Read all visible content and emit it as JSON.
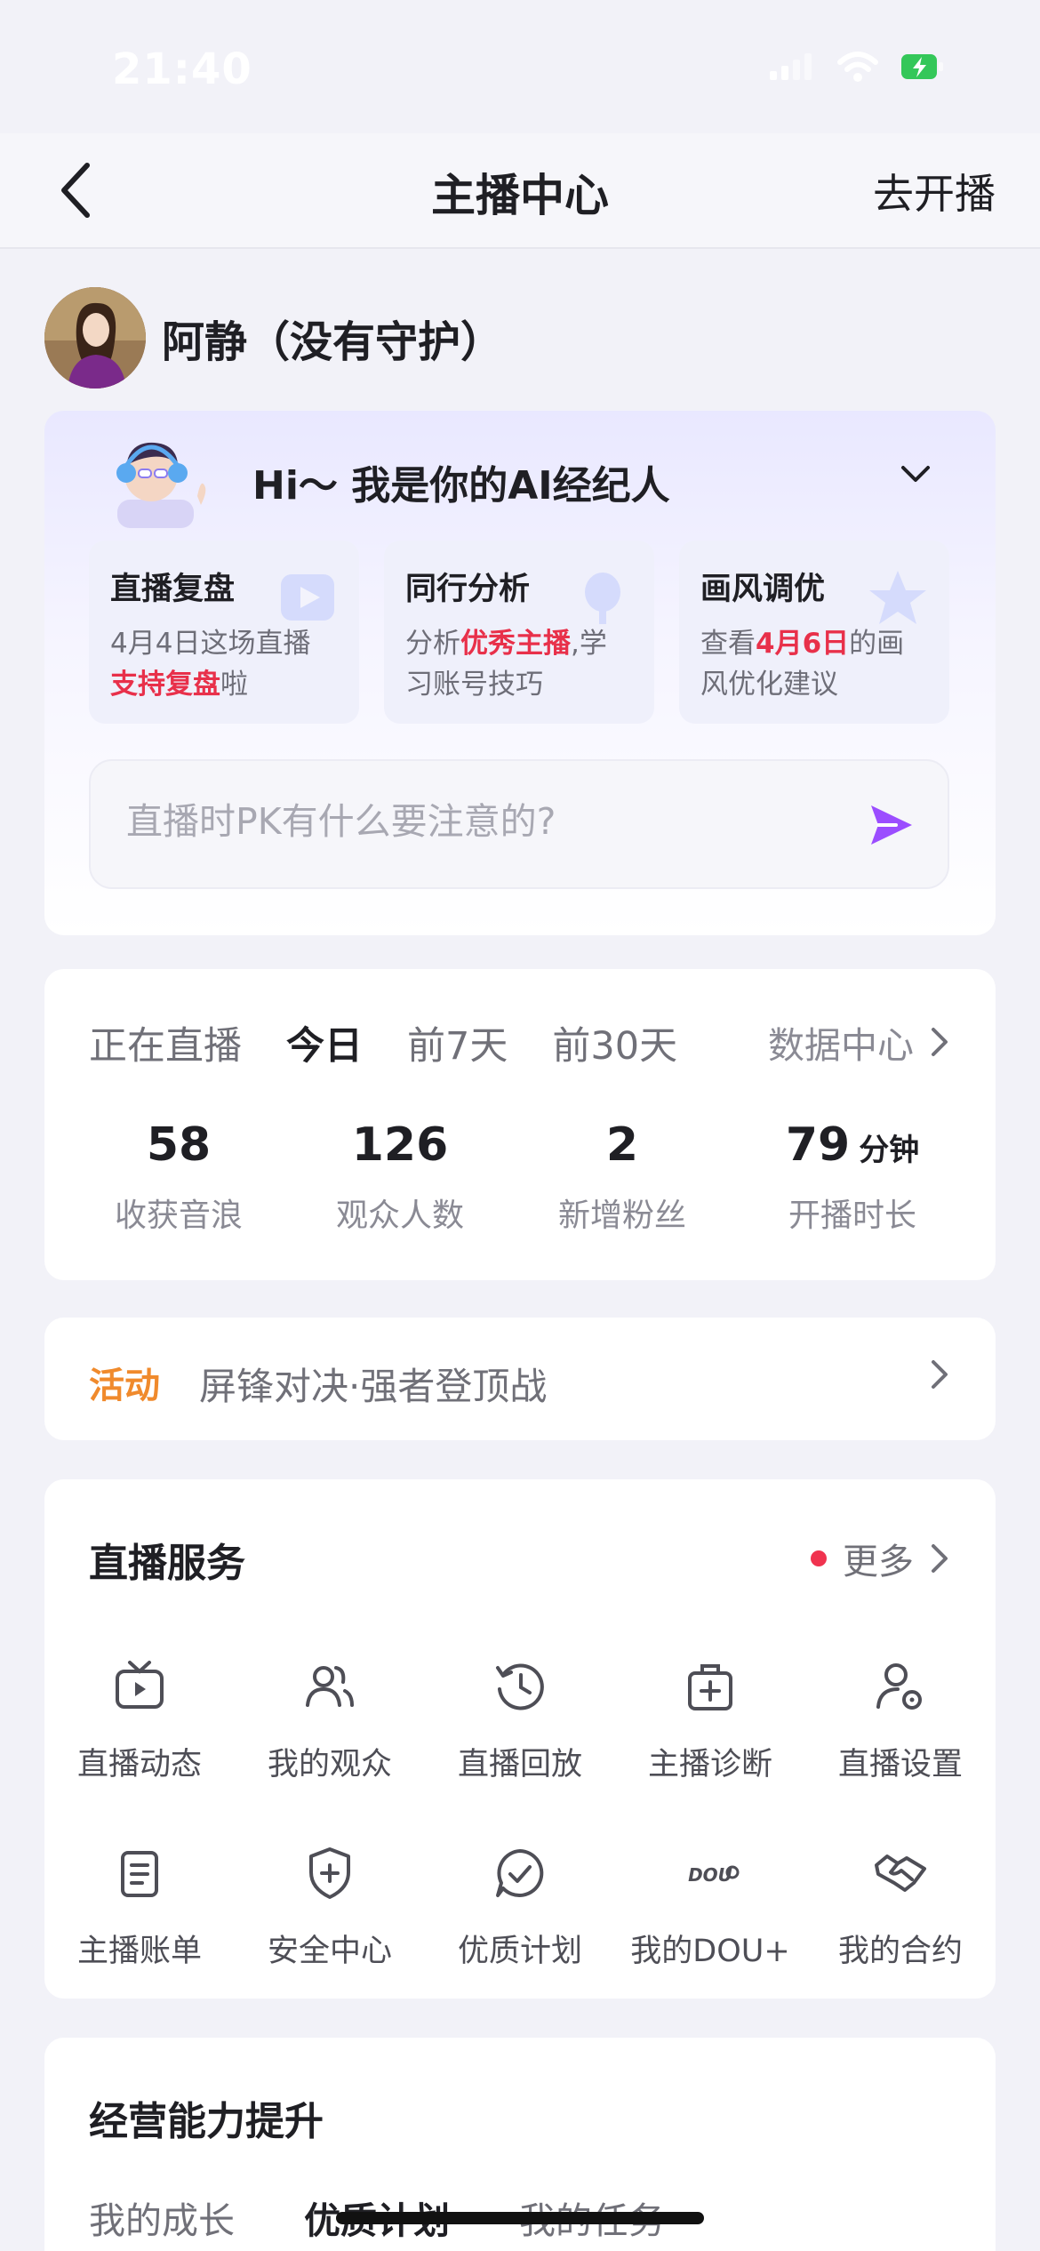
{
  "status_bar": {
    "time": "21:40",
    "icons": [
      "signal-icon",
      "wifi-icon",
      "battery-charging-icon"
    ]
  },
  "nav": {
    "back_icon": "chevron-left-icon",
    "title": "主播中心",
    "right_action": "去开播"
  },
  "profile": {
    "name": "阿静（没有守护）"
  },
  "ai_assistant": {
    "greeting": "Hi～ 我是你的AI经纪人",
    "cards": [
      {
        "title": "直播复盘",
        "desc_pre": "4月4日这场直播",
        "desc_hl": "支持复盘",
        "desc_post": "啦"
      },
      {
        "title": "同行分析",
        "desc_pre": "分析",
        "desc_hl": "优秀主播",
        "desc_post": ",学习账号技巧"
      },
      {
        "title": "画风调优",
        "desc_pre": "查看",
        "desc_hl": "4月6日",
        "desc_post": "的画风优化建议"
      }
    ],
    "input_placeholder": "直播时PK有什么要注意的?",
    "highlight_color": "#e8304a",
    "send_color": "#9b4dff"
  },
  "stats": {
    "tabs": [
      "正在直播",
      "今日",
      "前7天",
      "前30天"
    ],
    "active_tab": "今日",
    "link": "数据中心",
    "items": [
      {
        "value": "58",
        "unit": "",
        "label": "收获音浪"
      },
      {
        "value": "126",
        "unit": "",
        "label": "观众人数"
      },
      {
        "value": "2",
        "unit": "",
        "label": "新增粉丝"
      },
      {
        "value": "79",
        "unit": "分钟",
        "label": "开播时长"
      }
    ]
  },
  "activity": {
    "tag": "活动",
    "text": "屏锋对决·强者登顶战",
    "tag_color": "#f08a2c"
  },
  "services": {
    "title": "直播服务",
    "more": "更多",
    "items": [
      {
        "icon": "tv-icon",
        "label": "直播动态"
      },
      {
        "icon": "audience-icon",
        "label": "我的观众"
      },
      {
        "icon": "history-icon",
        "label": "直播回放"
      },
      {
        "icon": "medical-kit-icon",
        "label": "主播诊断"
      },
      {
        "icon": "user-settings-icon",
        "label": "直播设置"
      },
      {
        "icon": "bill-icon",
        "label": "主播账单"
      },
      {
        "icon": "shield-plus-icon",
        "label": "安全中心"
      },
      {
        "icon": "check-chat-icon",
        "label": "优质计划"
      },
      {
        "icon": "dou-plus-icon",
        "label": "我的DOU+"
      },
      {
        "icon": "handshake-icon",
        "label": "我的合约"
      }
    ]
  },
  "growth": {
    "title": "经营能力提升",
    "tabs": [
      "我的成长",
      "优质计划",
      "我的任务"
    ],
    "active_tab": "优质计划"
  }
}
